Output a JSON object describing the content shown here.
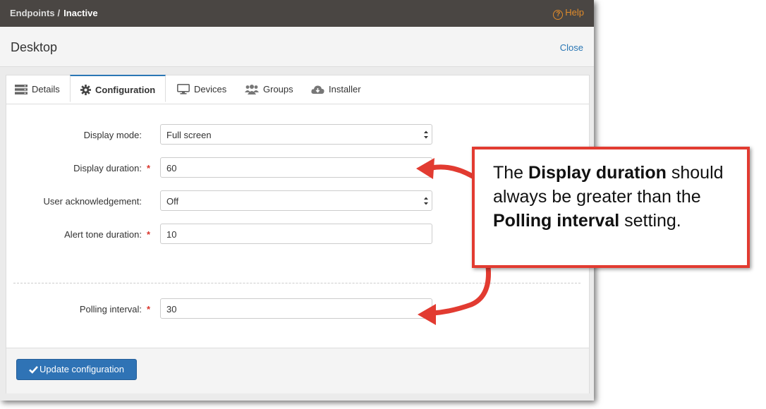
{
  "breadcrumb": {
    "parent": "Endpoints",
    "separator": "/",
    "current": "Inactive"
  },
  "help": {
    "label": "Help",
    "icon": "question-circle-icon"
  },
  "panel": {
    "title": "Desktop",
    "close_label": "Close"
  },
  "tabs": [
    {
      "label": "Details",
      "icon": "list-icon"
    },
    {
      "label": "Configuration",
      "icon": "gear-icon",
      "active": true
    },
    {
      "label": "Devices",
      "icon": "monitor-icon"
    },
    {
      "label": "Groups",
      "icon": "users-icon"
    },
    {
      "label": "Installer",
      "icon": "cloud-download-icon"
    }
  ],
  "form": {
    "display_mode": {
      "label": "Display mode:",
      "value": "Full screen"
    },
    "display_duration": {
      "label": "Display duration:",
      "value": "60",
      "required": "*"
    },
    "user_ack": {
      "label": "User acknowledgement:",
      "value": "Off"
    },
    "alert_tone": {
      "label": "Alert tone duration:",
      "value": "10",
      "required": "*"
    },
    "polling": {
      "label": "Polling interval:",
      "value": "30",
      "required": "*"
    }
  },
  "footer": {
    "update_label": "Update configuration",
    "icon": "check-icon"
  },
  "callout": {
    "t1": "The ",
    "b1": "Display duration",
    "t2": " should always be greater than the ",
    "b2": "Polling interval",
    "t3": " setting."
  },
  "colors": {
    "topbar": "#4a4643",
    "accent": "#2a77b5",
    "help": "#e08b2b",
    "required": "#d9342b",
    "callout_border": "#e23b31"
  }
}
